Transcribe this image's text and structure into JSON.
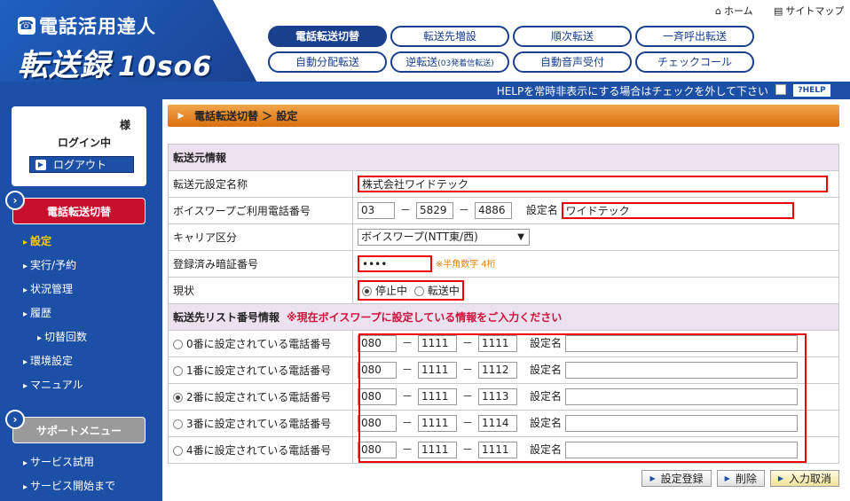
{
  "header": {
    "logo_line1": "電話活用達人",
    "logo_line2": "転送録",
    "logo_version": "10so6",
    "home_link": "ホーム",
    "sitemap_link": "サイトマップ",
    "tabs_row1": [
      "電話転送切替",
      "転送先増設",
      "順次転送",
      "一斉呼出転送"
    ],
    "tabs_row2": [
      "自動分配転送",
      "逆転送",
      "自動音声受付",
      "チェックコール"
    ],
    "tab_reverse_sub": "(03発着信転送)"
  },
  "helpbar": {
    "text": "HELPを常時非表示にする場合はチェックを外して下さい",
    "help_button": "?HELP"
  },
  "sidebar": {
    "user_suffix": "様",
    "login_status": "ログイン中",
    "logout_label": "ログアウト",
    "section_main": "電話転送切替",
    "items_main": [
      "設定",
      "実行/予約",
      "状況管理",
      "履歴",
      "切替回数",
      "環境設定",
      "マニュアル"
    ],
    "section_support": "サポートメニュー",
    "items_support": [
      "サービス試用",
      "サービス開始まで"
    ]
  },
  "main": {
    "breadcrumb": "電話転送切替 ＞ 設定",
    "source_section": "転送元情報",
    "source_name_label": "転送元設定名称",
    "source_name_value": "株式会社ワイドテック",
    "phone_label": "ボイスワープご利用電話番号",
    "phone": [
      "03",
      "5829",
      "4886"
    ],
    "setting_name_label": "設定名",
    "phone_setting_name": "ワイドテック",
    "carrier_label": "キャリア区分",
    "carrier_value": "ボイスワープ(NTT東/西)",
    "pin_label": "登録済み暗証番号",
    "pin_value": "••••",
    "pin_note": "※半角数字 4桁",
    "status_label": "現状",
    "status_options": [
      "停止中",
      "転送中"
    ],
    "dest_section": "転送先リスト番号情報",
    "dest_warning": "※現在ボイスワープに設定している情報をご入力ください",
    "destinations": [
      {
        "label": "0番に設定されている電話番号",
        "num": [
          "080",
          "1111",
          "1111"
        ],
        "name": ""
      },
      {
        "label": "1番に設定されている電話番号",
        "num": [
          "080",
          "1111",
          "1112"
        ],
        "name": ""
      },
      {
        "label": "2番に設定されている電話番号",
        "num": [
          "080",
          "1111",
          "1113"
        ],
        "name": ""
      },
      {
        "label": "3番に設定されている電話番号",
        "num": [
          "080",
          "1111",
          "1114"
        ],
        "name": ""
      },
      {
        "label": "4番に設定されている電話番号",
        "num": [
          "080",
          "1111",
          "1111"
        ],
        "name": ""
      }
    ],
    "dash": "－",
    "btn_register": "設定登録",
    "btn_delete": "削除",
    "btn_cancel": "入力取消"
  }
}
